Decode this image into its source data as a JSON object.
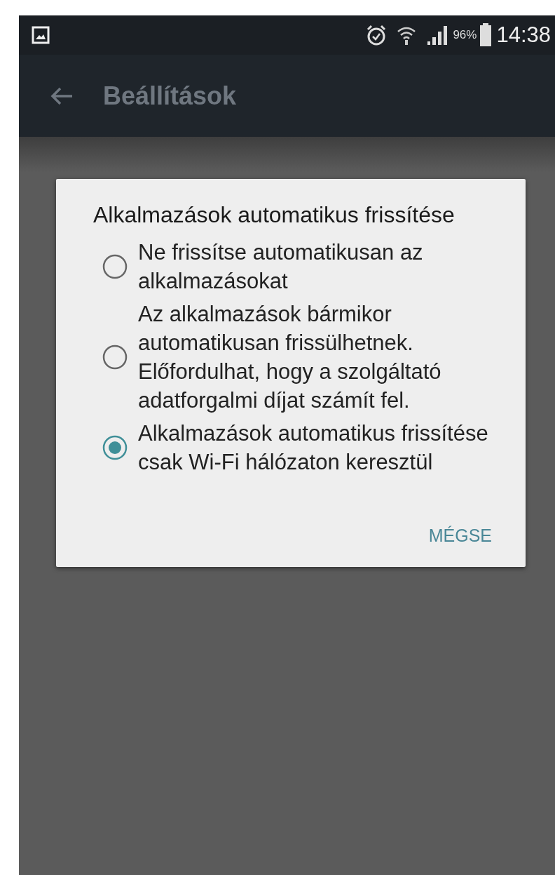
{
  "status_bar": {
    "battery_percent": "96%",
    "time": "14:38"
  },
  "toolbar": {
    "title": "Beállítások"
  },
  "dialog": {
    "title": "Alkalmazások automatikus frissítése",
    "options": [
      {
        "label": "Ne frissítse automatikusan az alkalmazásokat",
        "selected": false
      },
      {
        "label": "Az alkalmazások bármikor automatikusan frissülhetnek. Előfordulhat, hogy a szolgáltató adatforgalmi díjat számít fel.",
        "selected": false
      },
      {
        "label": "Alkalmazások automatikus frissítése csak Wi-Fi hálózaton keresztül",
        "selected": true
      }
    ],
    "buttons": [
      "MÉGSE"
    ]
  }
}
